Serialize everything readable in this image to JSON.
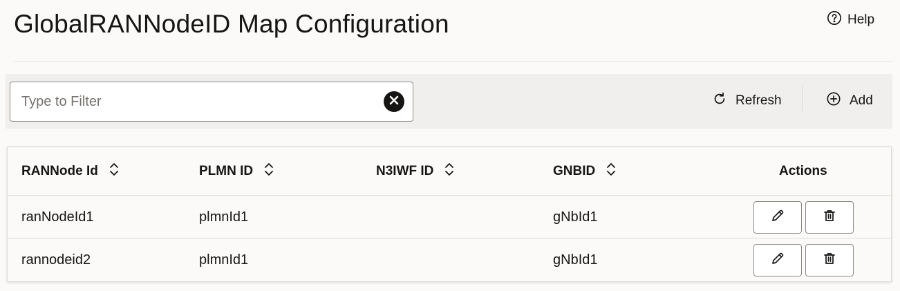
{
  "header": {
    "title": "GlobalRANNodeID Map Configuration",
    "help_label": "Help"
  },
  "toolbar": {
    "filter_placeholder": "Type to Filter",
    "filter_value": "",
    "refresh_label": "Refresh",
    "add_label": "Add"
  },
  "table": {
    "columns": [
      "RANNode Id",
      "PLMN ID",
      "N3IWF ID",
      "GNBID",
      "Actions"
    ],
    "rows": [
      {
        "rannode_id": "ranNodeId1",
        "plmn_id": "plmnId1",
        "n3iwf_id": "",
        "gnbid": "gNbId1"
      },
      {
        "rannode_id": "rannodeid2",
        "plmn_id": "plmnId1",
        "n3iwf_id": "",
        "gnbid": "gNbId1"
      }
    ]
  },
  "icons": {
    "help": "help-circle-icon",
    "clear": "clear-filter-icon",
    "refresh": "refresh-icon",
    "add": "add-circle-icon",
    "sort": "sort-icon",
    "edit": "pencil-icon",
    "delete": "trash-icon"
  }
}
